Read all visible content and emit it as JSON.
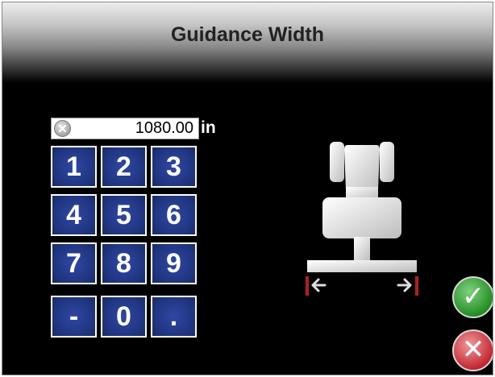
{
  "title": "Guidance Width",
  "entry": {
    "value": "1080.00",
    "unit": "in",
    "clear_icon": "clear-x-icon"
  },
  "keypad": [
    "1",
    "2",
    "3",
    "4",
    "5",
    "6",
    "7",
    "8",
    "9",
    "-",
    "0",
    "."
  ],
  "buttons": {
    "confirm_icon": "checkmark-icon",
    "cancel_icon": "x-icon"
  },
  "colors": {
    "key_blue": "#2a3f96",
    "confirm_green": "#2e9e2e",
    "cancel_red": "#d0303a"
  }
}
